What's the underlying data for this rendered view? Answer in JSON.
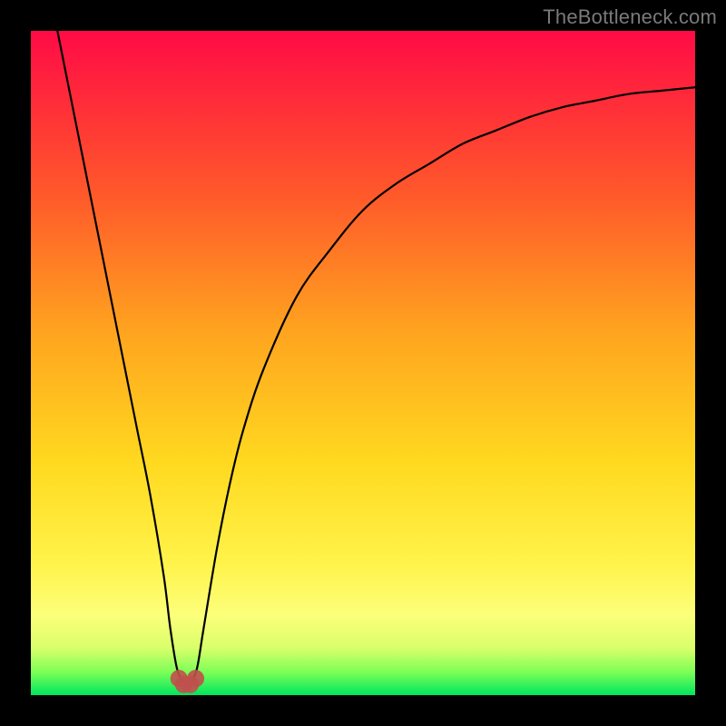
{
  "watermark": "TheBottleneck.com",
  "chart_data": {
    "type": "line",
    "title": "",
    "xlabel": "",
    "ylabel": "",
    "xlim": [
      0,
      100
    ],
    "ylim": [
      0,
      100
    ],
    "grid": false,
    "legend": false,
    "annotations": [],
    "series": [
      {
        "name": "bottleneck-curve",
        "color": "#000000",
        "x": [
          4,
          6,
          8,
          10,
          12,
          14,
          16,
          18,
          20,
          21,
          22,
          23,
          24,
          25,
          26,
          28,
          30,
          32,
          35,
          40,
          45,
          50,
          55,
          60,
          65,
          70,
          75,
          80,
          85,
          90,
          95,
          100
        ],
        "y": [
          100,
          90,
          80,
          70,
          60,
          50,
          40,
          30,
          18,
          10,
          4,
          2,
          2,
          4,
          10,
          22,
          32,
          40,
          49,
          60,
          67,
          73,
          77,
          80,
          83,
          85,
          87,
          88.5,
          89.5,
          90.5,
          91,
          91.5
        ]
      }
    ],
    "markers": [
      {
        "name": "min-marker-left",
        "x": 22.3,
        "y": 2.5,
        "r": 1.3,
        "color": "#c0504d"
      },
      {
        "name": "min-marker-mid1",
        "x": 23.0,
        "y": 1.6,
        "r": 1.3,
        "color": "#c0504d"
      },
      {
        "name": "min-marker-mid2",
        "x": 24.0,
        "y": 1.6,
        "r": 1.3,
        "color": "#c0504d"
      },
      {
        "name": "min-marker-right",
        "x": 24.8,
        "y": 2.5,
        "r": 1.3,
        "color": "#c0504d"
      }
    ],
    "background_gradient": {
      "type": "vertical",
      "stops": [
        {
          "offset": 0.0,
          "color": "#ff0b46"
        },
        {
          "offset": 0.1,
          "color": "#ff2a3a"
        },
        {
          "offset": 0.25,
          "color": "#ff5a2a"
        },
        {
          "offset": 0.45,
          "color": "#ffa31f"
        },
        {
          "offset": 0.65,
          "color": "#ffd91f"
        },
        {
          "offset": 0.8,
          "color": "#fff34a"
        },
        {
          "offset": 0.88,
          "color": "#fcff7a"
        },
        {
          "offset": 0.93,
          "color": "#d8ff6a"
        },
        {
          "offset": 0.965,
          "color": "#7dff57"
        },
        {
          "offset": 1.0,
          "color": "#00e55e"
        }
      ]
    }
  }
}
